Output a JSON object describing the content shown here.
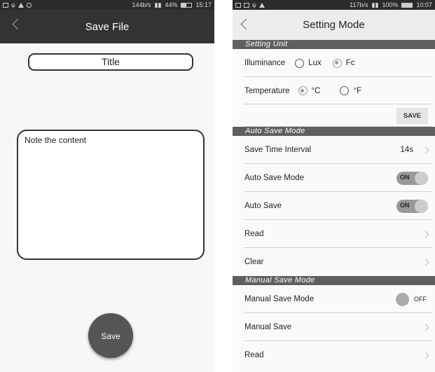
{
  "left": {
    "status": {
      "speed": "144b/s",
      "battery": "44%",
      "time": "15:17",
      "battery_level": 0.44
    },
    "appbar_title": "Save File",
    "title_field": "Title",
    "note_field": "Note the content",
    "save_button": "Save"
  },
  "right": {
    "status": {
      "speed": "117b/s",
      "battery": "100%",
      "time": "10:07",
      "battery_level": 1.0
    },
    "appbar_title": "Setting Mode",
    "setting_unit": {
      "header": "Setting Unit",
      "illuminance": {
        "label": "Illuminance",
        "options": [
          "Lux",
          "Fc"
        ],
        "selected": "Fc"
      },
      "temperature": {
        "label": "Temperature",
        "options": [
          "°C",
          "°F"
        ],
        "selected": "°C"
      },
      "save_label": "SAVE"
    },
    "auto_save": {
      "header": "Auto Save Mode",
      "interval_label": "Save Time Interval",
      "interval_value": "14s",
      "mode_label": "Auto Save Mode",
      "mode_toggle": "ON",
      "auto_label": "Auto Save",
      "auto_toggle": "ON",
      "read_label": "Read",
      "clear_label": "Clear"
    },
    "manual_save": {
      "header": "Manual Save Mode",
      "mode_label": "Manual Save Mode",
      "mode_toggle": "OFF",
      "save_label": "Manual Save",
      "read_label": "Read"
    }
  }
}
